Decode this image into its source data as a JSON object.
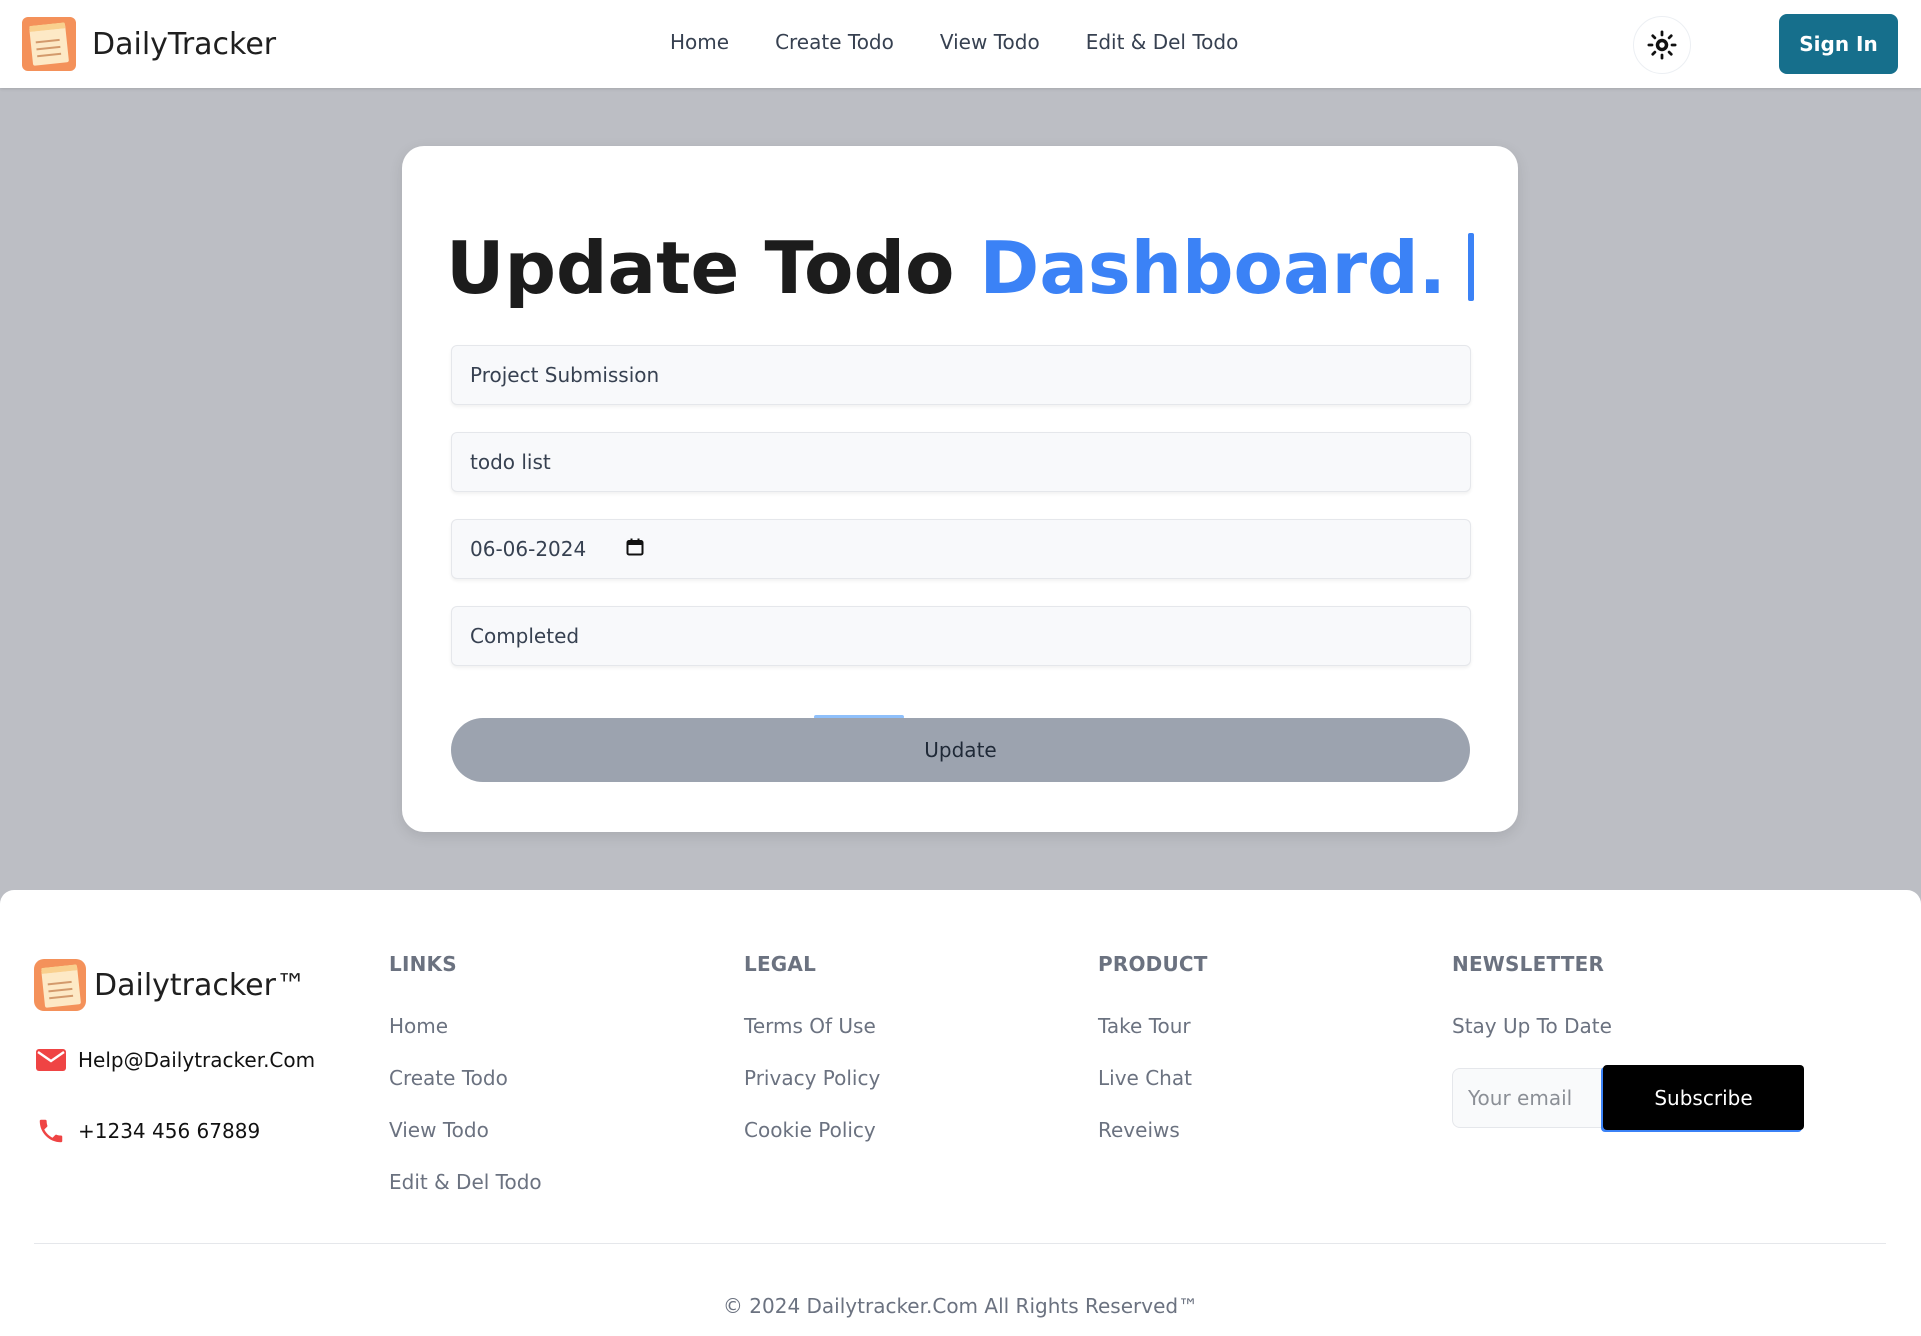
{
  "header": {
    "brand": "DailyTracker",
    "nav": [
      "Home",
      "Create Todo",
      "View Todo",
      "Edit & Del Todo"
    ],
    "theme_icon": "sun-icon",
    "signin_label": "Sign In"
  },
  "form": {
    "title_main": "Update Todo",
    "title_accent": "Dashboard.",
    "fields": {
      "title_value": "Project Submission",
      "description_value": "todo list",
      "date_value": "06-06-2024",
      "status_value": "Completed"
    },
    "submit_label": "Update"
  },
  "footer": {
    "brand": "Dailytracker™",
    "email": "Help@Dailytracker.Com",
    "phone": "+1234 456 67889",
    "links": {
      "heading": "LINKS",
      "items": [
        "Home",
        "Create Todo",
        "View Todo",
        "Edit & Del Todo"
      ]
    },
    "legal": {
      "heading": "LEGAL",
      "items": [
        "Terms Of Use",
        "Privacy Policy",
        "Cookie Policy"
      ]
    },
    "product": {
      "heading": "PRODUCT",
      "items": [
        "Take Tour",
        "Live Chat",
        "Reveiws"
      ]
    },
    "newsletter": {
      "heading": "NEWSLETTER",
      "text": "Stay Up To Date",
      "email_placeholder": "Your email",
      "subscribe_label": "Subscribe"
    },
    "copyright": "© 2024 Dailytracker.Com All Rights Reserved™"
  },
  "colors": {
    "accent": "#3b82f6",
    "signin_bg": "#166f8c",
    "logo_bg": "#f4915a",
    "page_bg": "#bcbec4"
  }
}
